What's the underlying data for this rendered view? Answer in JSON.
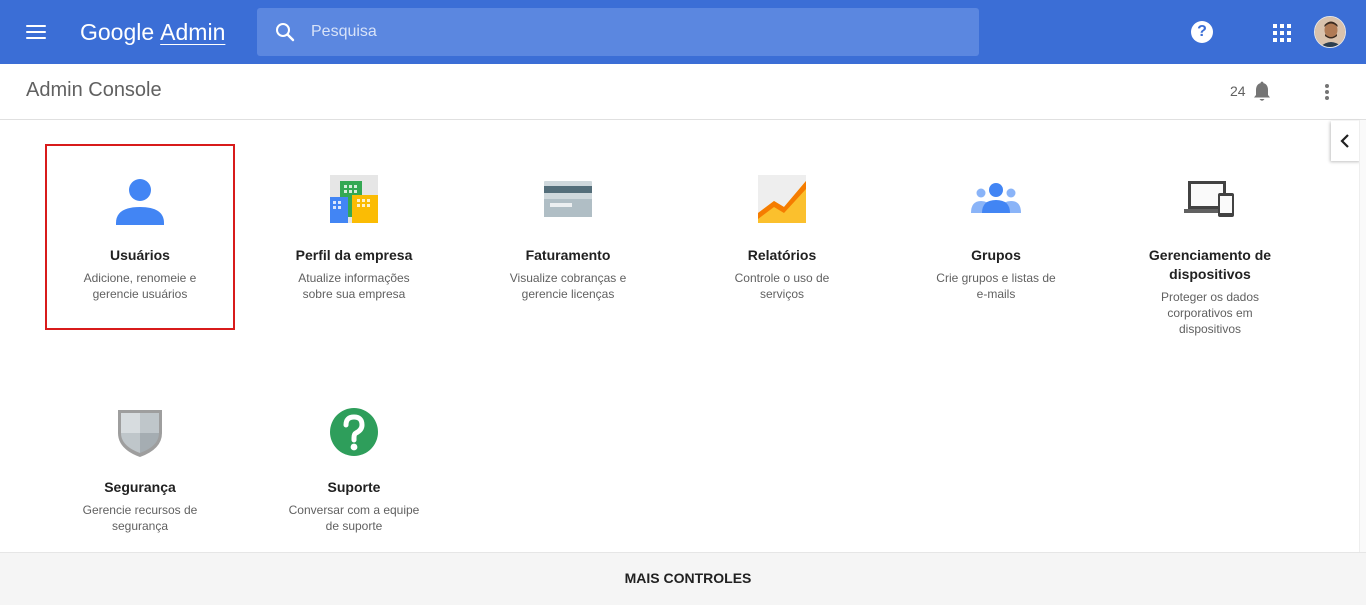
{
  "topbar": {
    "brand_google": "Google",
    "brand_admin": "Admin",
    "search_placeholder": "Pesquisa",
    "help_symbol": "?"
  },
  "header": {
    "title": "Admin Console",
    "notification_count": "24"
  },
  "tiles": [
    {
      "title": "Usuários",
      "desc": [
        "Adicione, renomeie e",
        "gerencie usuários"
      ],
      "icon": "user-icon",
      "selected": true
    },
    {
      "title": "Perfil da empresa",
      "desc": [
        "Atualize informações",
        "sobre sua empresa"
      ],
      "icon": "company-building-icon"
    },
    {
      "title": "Faturamento",
      "desc": [
        "Visualize cobranças e",
        "gerencie licenças"
      ],
      "icon": "credit-card-icon"
    },
    {
      "title": "Relatórios",
      "desc": [
        "Controle o uso de",
        "serviços"
      ],
      "icon": "report-chart-icon"
    },
    {
      "title": "Grupos",
      "desc": [
        "Crie grupos e listas de",
        "e-mails"
      ],
      "icon": "groups-icon"
    },
    {
      "title": [
        "Gerenciamento de",
        "dispositivos"
      ],
      "desc": [
        "Proteger os dados",
        "corporativos em",
        "dispositivos"
      ],
      "icon": "devices-icon"
    },
    {
      "title": "Segurança",
      "desc": [
        "Gerencie recursos de",
        "segurança"
      ],
      "icon": "shield-icon"
    },
    {
      "title": "Suporte",
      "desc": [
        "Conversar com a equipe",
        "de suporte"
      ],
      "icon": "help-circle-icon"
    }
  ],
  "footer": {
    "more_controls": "MAIS CONTROLES"
  },
  "colors": {
    "topbar": "#3b6ed6",
    "selection_border": "#d81b1b"
  }
}
